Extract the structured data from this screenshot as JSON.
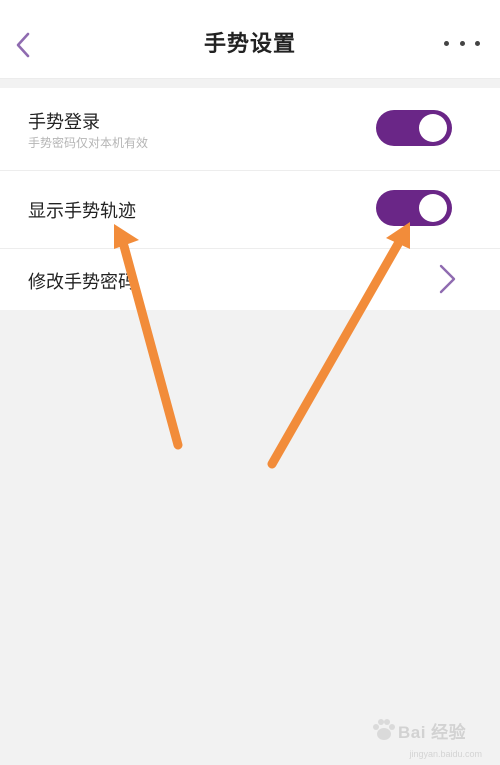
{
  "header": {
    "title": "手势设置",
    "back_icon": "chevron-left-icon",
    "more_icon": "more-horizontal-icon"
  },
  "settings": {
    "gesture_login": {
      "label": "手势登录",
      "sublabel": "手势密码仅对本机有效",
      "enabled": true
    },
    "show_trail": {
      "label": "显示手势轨迹",
      "enabled": true
    },
    "change_password": {
      "label": "修改手势密码",
      "arrow_icon": "chevron-right-icon"
    }
  },
  "colors": {
    "accent": "#6a2687",
    "chevron": "#8f6bb0",
    "annotation_arrow": "#f28c3a",
    "background": "#f2f2f2"
  },
  "annotations": {
    "arrow_icon": "annotation-arrow-icon"
  },
  "watermark": {
    "text": "Bai 经验",
    "domain": "jingyan.baidu.com",
    "logo_icon": "baidu-paw-icon"
  }
}
